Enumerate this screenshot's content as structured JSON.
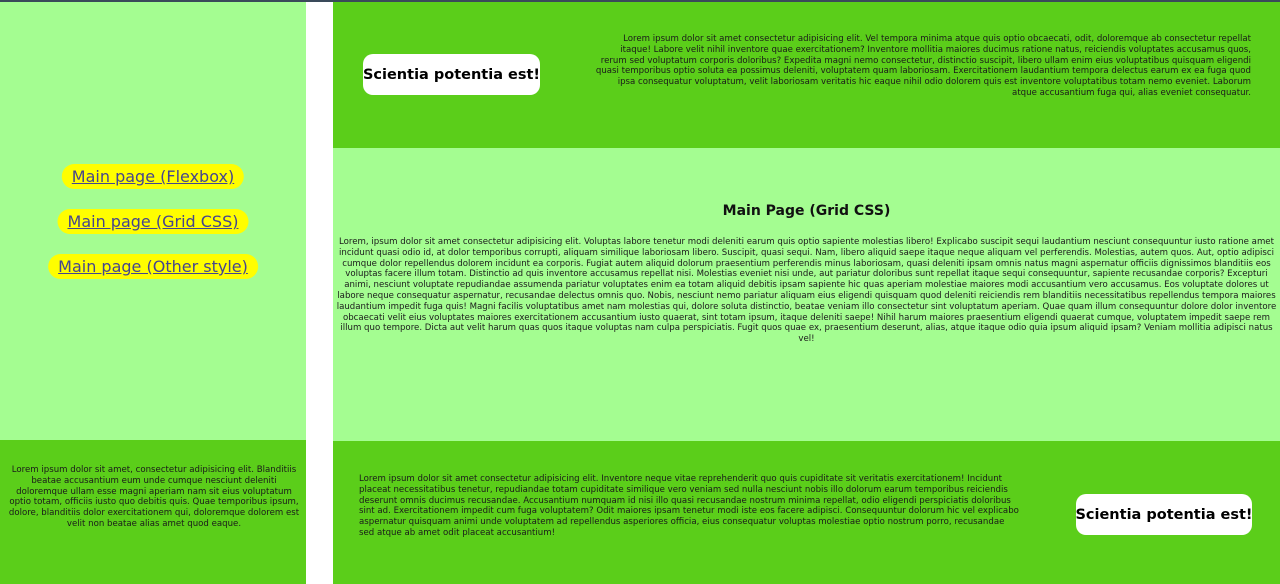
{
  "nav": {
    "links": [
      {
        "label": "Main page (Flexbox)"
      },
      {
        "label": "Main page (Grid CSS)"
      },
      {
        "label": "Main page (Other style)"
      }
    ]
  },
  "header": {
    "badge": "Scientia potentia est!",
    "text": "Lorem ipsum dolor sit amet consectetur adipisicing elit. Vel tempora minima atque quis optio obcaecati, odit, doloremque ab consectetur repellat itaque! Labore velit nihil inventore quae exercitationem? Inventore mollitia maiores ducimus ratione natus, reiciendis voluptates accusamus quos, rerum sed voluptatum corporis doloribus? Expedita magni nemo consectetur, distinctio suscipit, libero ullam enim eius voluptatibus quisquam eligendi quasi temporibus optio soluta ea possimus deleniti, voluptatem quam laboriosam. Exercitationem laudantium tempora delectus earum ex ea fuga quod ipsa consequatur voluptatum, velit laboriosam veritatis hic eaque nihil odio dolorem quis est inventore voluptatibus totam nemo eveniet. Laborum atque accusantium fuga qui, alias eveniet consequatur."
  },
  "main": {
    "title": "Main Page (Grid CSS)",
    "text": "Lorem, ipsum dolor sit amet consectetur adipisicing elit. Voluptas labore tenetur modi deleniti earum quis optio sapiente molestias libero! Explicabo suscipit sequi laudantium nesciunt consequuntur iusto ratione amet incidunt quasi odio id, at dolor temporibus corrupti, aliquam similique laboriosam libero. Suscipit, quasi sequi. Nam, libero aliquid saepe itaque neque aliquam vel perferendis. Molestias, autem quos. Aut, optio adipisci cumque dolor repellendus dolorem incidunt ea corporis. Fugiat autem aliquid dolorum praesentium perferendis minus laboriosam, quasi deleniti ipsam omnis natus magni aspernatur officiis dignissimos blanditiis eos voluptas facere illum totam. Distinctio ad quis inventore accusamus repellat nisi. Molestias eveniet nisi unde, aut pariatur doloribus sunt repellat itaque sequi consequuntur, sapiente recusandae corporis? Excepturi animi, nesciunt voluptate repudiandae assumenda pariatur voluptates enim ea totam aliquid debitis ipsam sapiente hic quas aperiam molestiae maiores modi accusantium vero accusamus. Eos voluptate dolores ut labore neque consequatur aspernatur, recusandae delectus omnis quo. Nobis, nesciunt nemo pariatur aliquam eius eligendi quisquam quod deleniti reiciendis rem blanditiis necessitatibus repellendus tempora maiores laudantium impedit fuga quis! Magni facilis voluptatibus amet nam molestias qui, dolore soluta distinctio, beatae veniam illo consectetur sint voluptatum aperiam. Quae quam illum consequuntur dolore dolor inventore obcaecati velit eius voluptates maiores exercitationem accusantium iusto quaerat, sint totam ipsum, itaque deleniti saepe! Nihil harum maiores praesentium eligendi quaerat cumque, voluptatem impedit saepe rem illum quo tempore. Dicta aut velit harum quas quos itaque voluptas nam culpa perspiciatis. Fugit quos quae ex, praesentium deserunt, alias, atque itaque odio quia ipsum aliquid ipsam? Veniam mollitia adipisci natus vel!"
  },
  "footer_left": {
    "text": "Lorem ipsum dolor sit amet, consectetur adipisicing elit. Blanditiis beatae accusantium eum unde cumque nesciunt deleniti doloremque ullam esse magni aperiam nam sit eius voluptatum optio totam, officiis iusto quo debitis quis. Quae temporibus ipsum, dolore, blanditiis dolor exercitationem qui, doloremque dolorem est velit non beatae alias amet quod eaque."
  },
  "footer_right": {
    "text": "Lorem ipsum dolor sit amet consectetur adipisicing elit. Inventore neque vitae reprehenderit quo quis cupiditate sit veritatis exercitationem! Incidunt placeat necessitatibus tenetur, repudiandae totam cupiditate similique vero veniam sed nulla nesciunt nobis illo dolorum earum temporibus reiciendis deserunt omnis ducimus recusandae. Accusantium numquam id nisi illo quasi recusandae nostrum minima repellat, odio eligendi perspiciatis doloribus sint ad. Exercitationem impedit cum fuga voluptatem? Odit maiores ipsam tenetur modi iste eos facere adipisci. Consequuntur dolorum hic vel explicabo aspernatur quisquam animi unde voluptatem ad repellendus asperiores officia, eius consequatur voluptas molestiae optio nostrum porro, recusandae sed atque ab amet odit placeat accusantium!",
    "badge": "Scientia potentia est!"
  },
  "colors": {
    "light_green": "#a4fd91",
    "dark_green": "#5bce1a",
    "link_bg": "#fffe00"
  }
}
